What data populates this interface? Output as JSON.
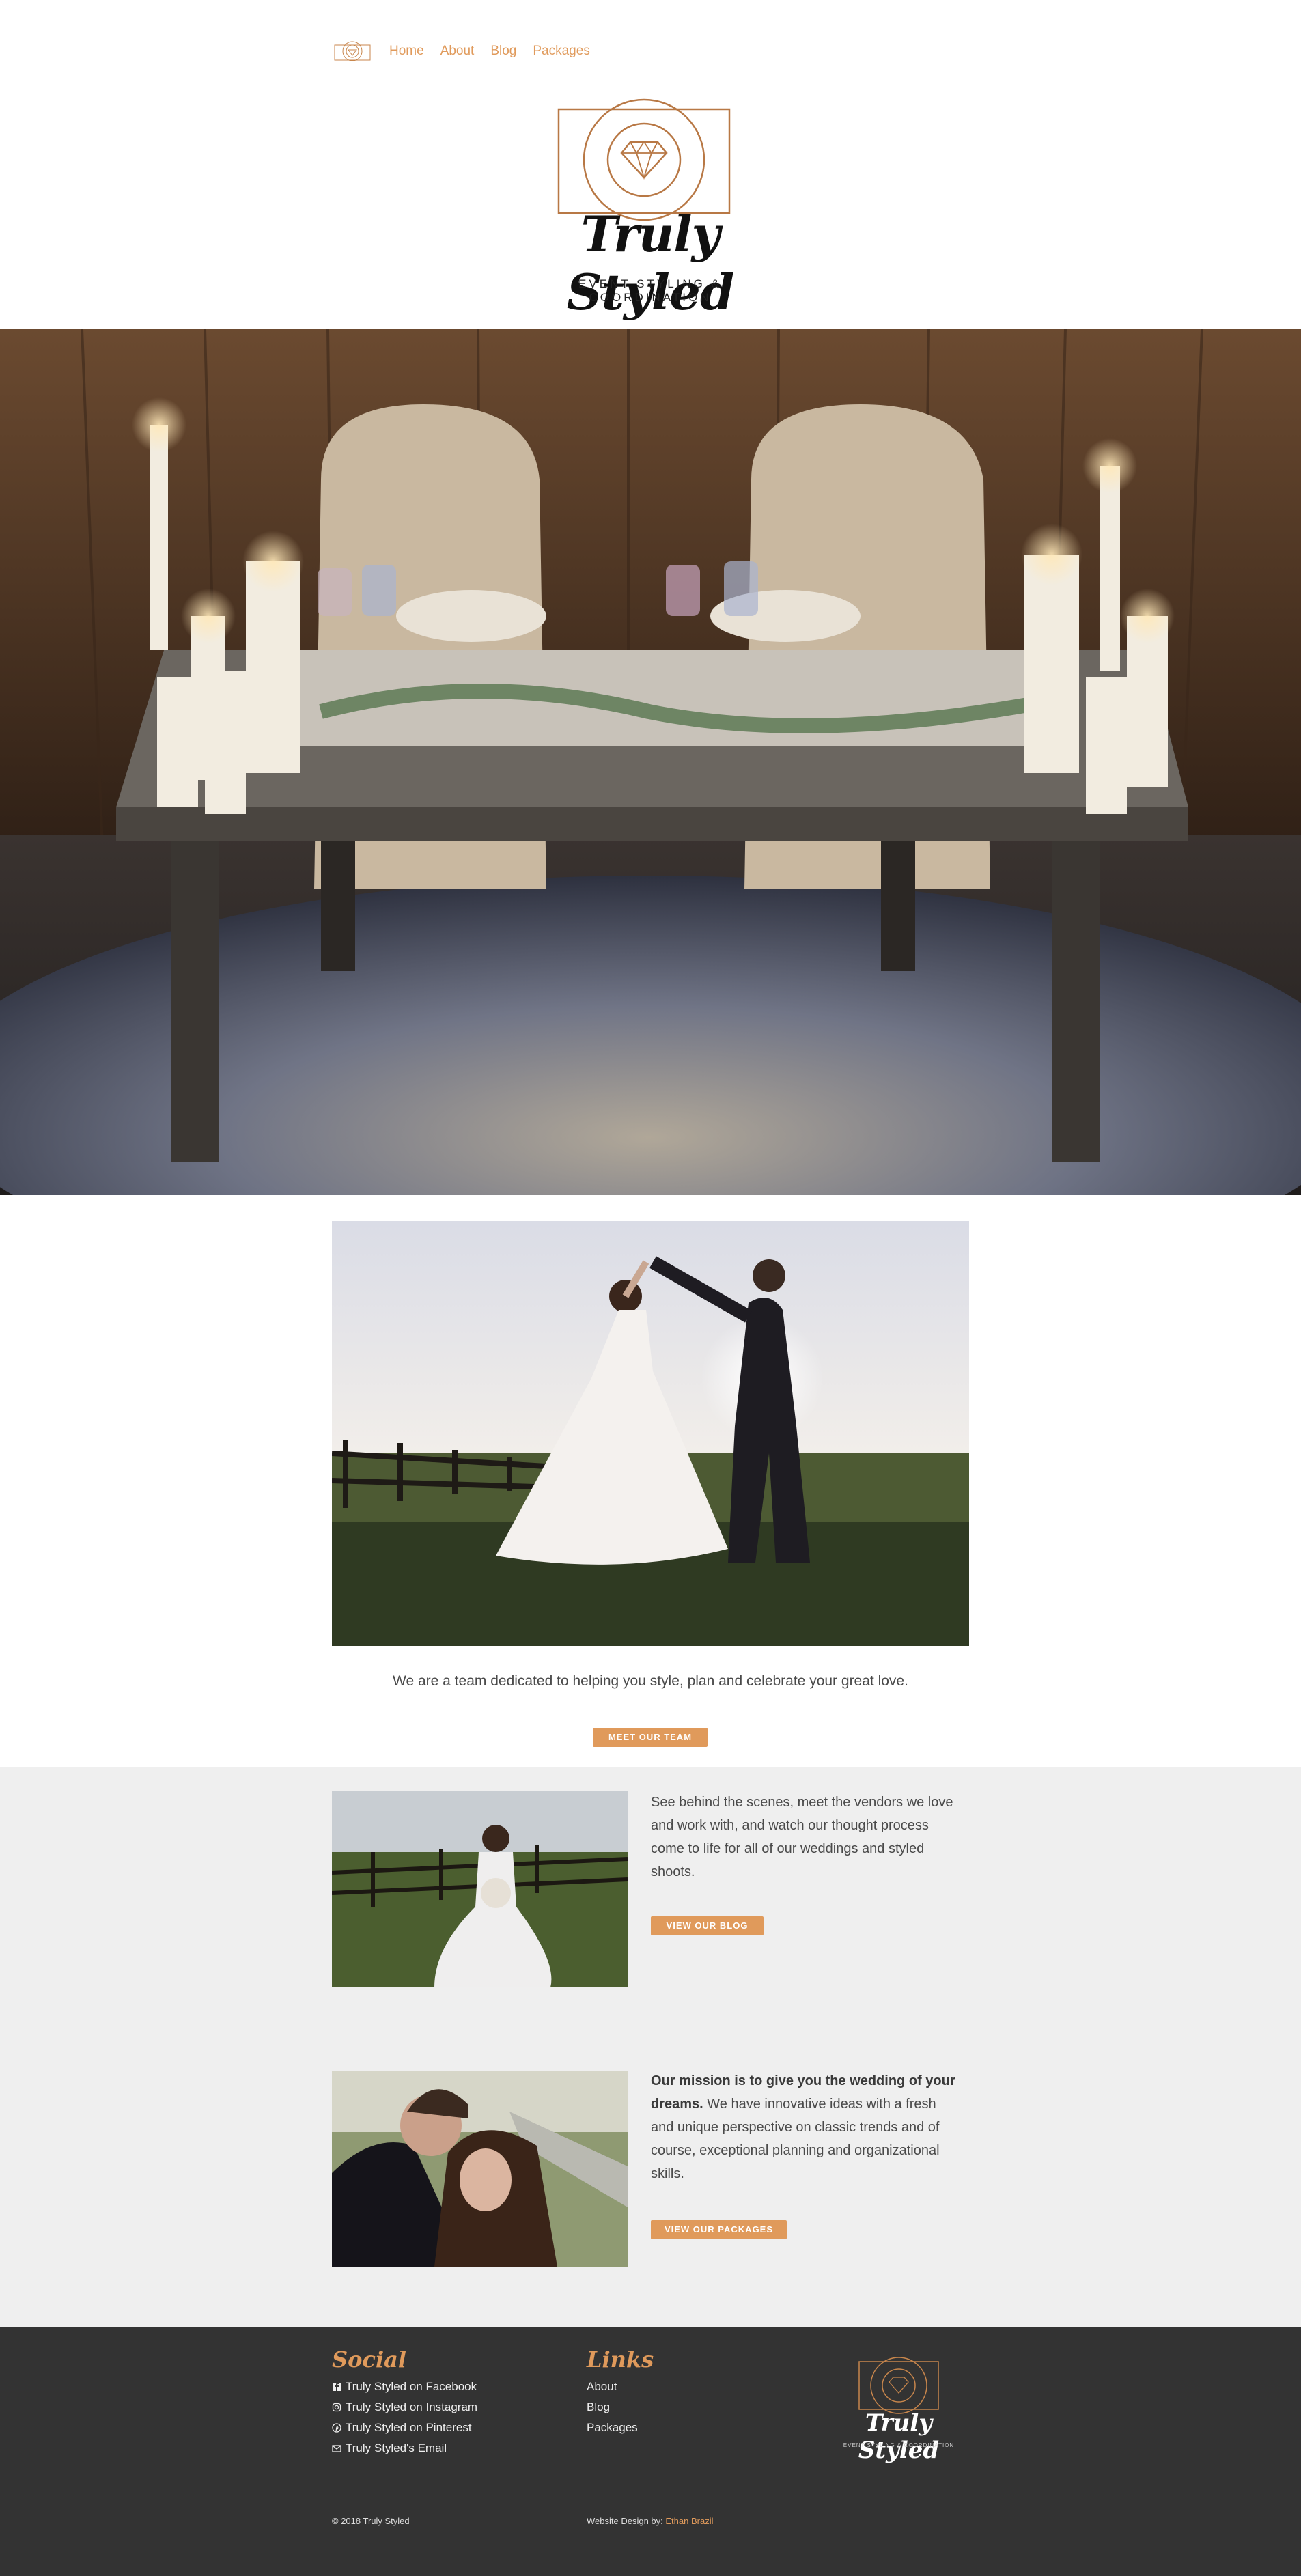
{
  "nav": {
    "items": [
      "Home",
      "About",
      "Blog",
      "Packages"
    ]
  },
  "brand": {
    "name": "Truly Styled",
    "tagline": "EVENT STYLING & COORDINATION"
  },
  "intro": {
    "text": "We are a team dedicated to helping you style, plan and celebrate your great love.",
    "button": "MEET OUR TEAM"
  },
  "blog": {
    "text": "See behind the scenes, meet the vendors we love and work with, and watch our thought process come to life for all of our weddings and styled shoots.",
    "button": "VIEW OUR BLOG"
  },
  "mission": {
    "lead": "Our mission is to give you the wedding of your dreams.",
    "text": " We have innovative ideas with a fresh and unique perspective on classic trends and of course, exceptional planning and organizational skills.",
    "button": "VIEW OUR PACKAGES"
  },
  "footer": {
    "social_title": "Social",
    "social": [
      {
        "icon": "facebook-icon",
        "label": "Truly Styled on Facebook"
      },
      {
        "icon": "instagram-icon",
        "label": "Truly Styled on Instagram"
      },
      {
        "icon": "pinterest-icon",
        "label": "Truly Styled on Pinterest"
      },
      {
        "icon": "email-icon",
        "label": "Truly Styled's Email"
      }
    ],
    "links_title": "Links",
    "links": [
      "About",
      "Blog",
      "Packages"
    ],
    "brand_name": "Truly Styled",
    "brand_tag": "EVENT STYLING & COORDINATION",
    "copyright": "© 2018 Truly Styled",
    "design_label": "Website Design by: ",
    "designer": "Ethan Brazil"
  },
  "colors": {
    "accent": "#e09a5b",
    "grey_band": "#efefef",
    "footer_bg": "#333333"
  }
}
